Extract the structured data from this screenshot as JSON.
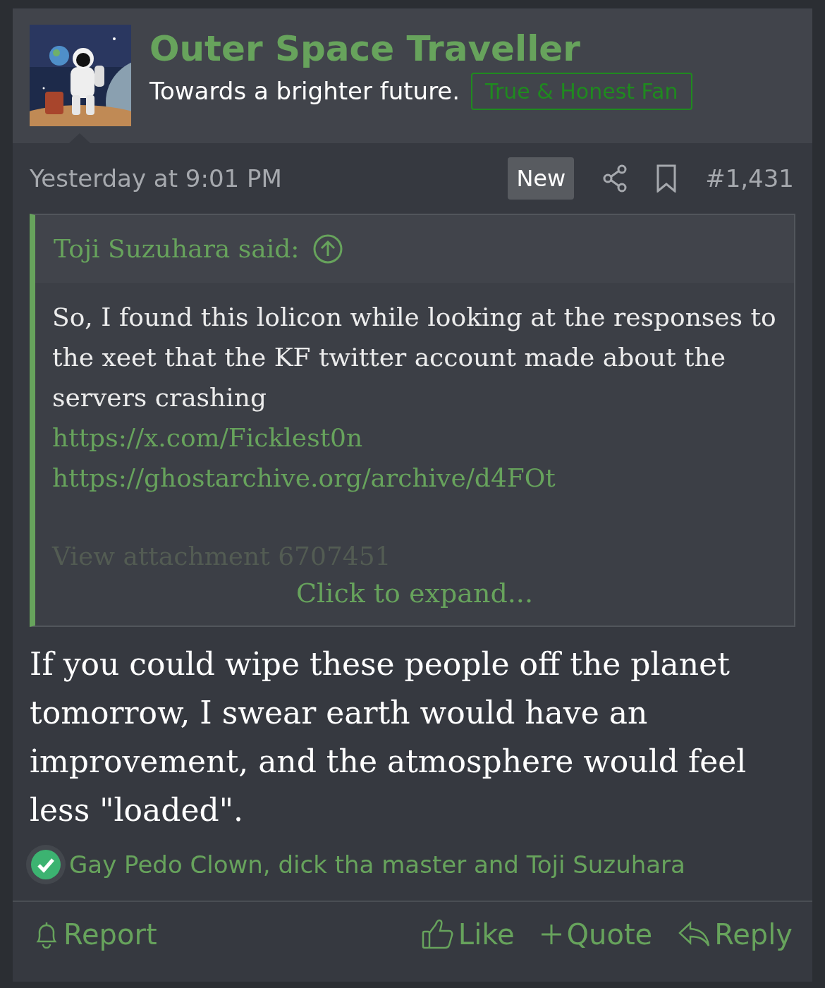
{
  "author": {
    "name": "Outer Space Traveller",
    "tagline": "Towards a brighter future.",
    "badge": "True & Honest Fan"
  },
  "meta": {
    "date": "Yesterday at 9:01 PM",
    "new_label": "New",
    "post_number": "#1,431"
  },
  "quote": {
    "said": "Toji Suzuhara said:",
    "text": "So, I found this lolicon while looking at the responses to the xeet that the KF twitter account made about the servers crashing",
    "links": [
      "https://x.com/Ficklest0n",
      "https://ghostarchive.org/archive/d4FOt"
    ],
    "attachment": "View attachment 6707451",
    "expand": "Click to expand..."
  },
  "body": "If you could wipe these people off the planet tomorrow, I swear earth would have an improvement, and the atmosphere would feel less \"loaded\".",
  "reactions": "Gay Pedo Clown, dick tha master and Toji Suzuhara",
  "actions": [
    {
      "kind": "report",
      "label": "Report"
    },
    {
      "kind": "like",
      "label": "Like"
    },
    {
      "kind": "quote",
      "label": "Quote"
    },
    {
      "kind": "reply",
      "label": "Reply"
    }
  ]
}
